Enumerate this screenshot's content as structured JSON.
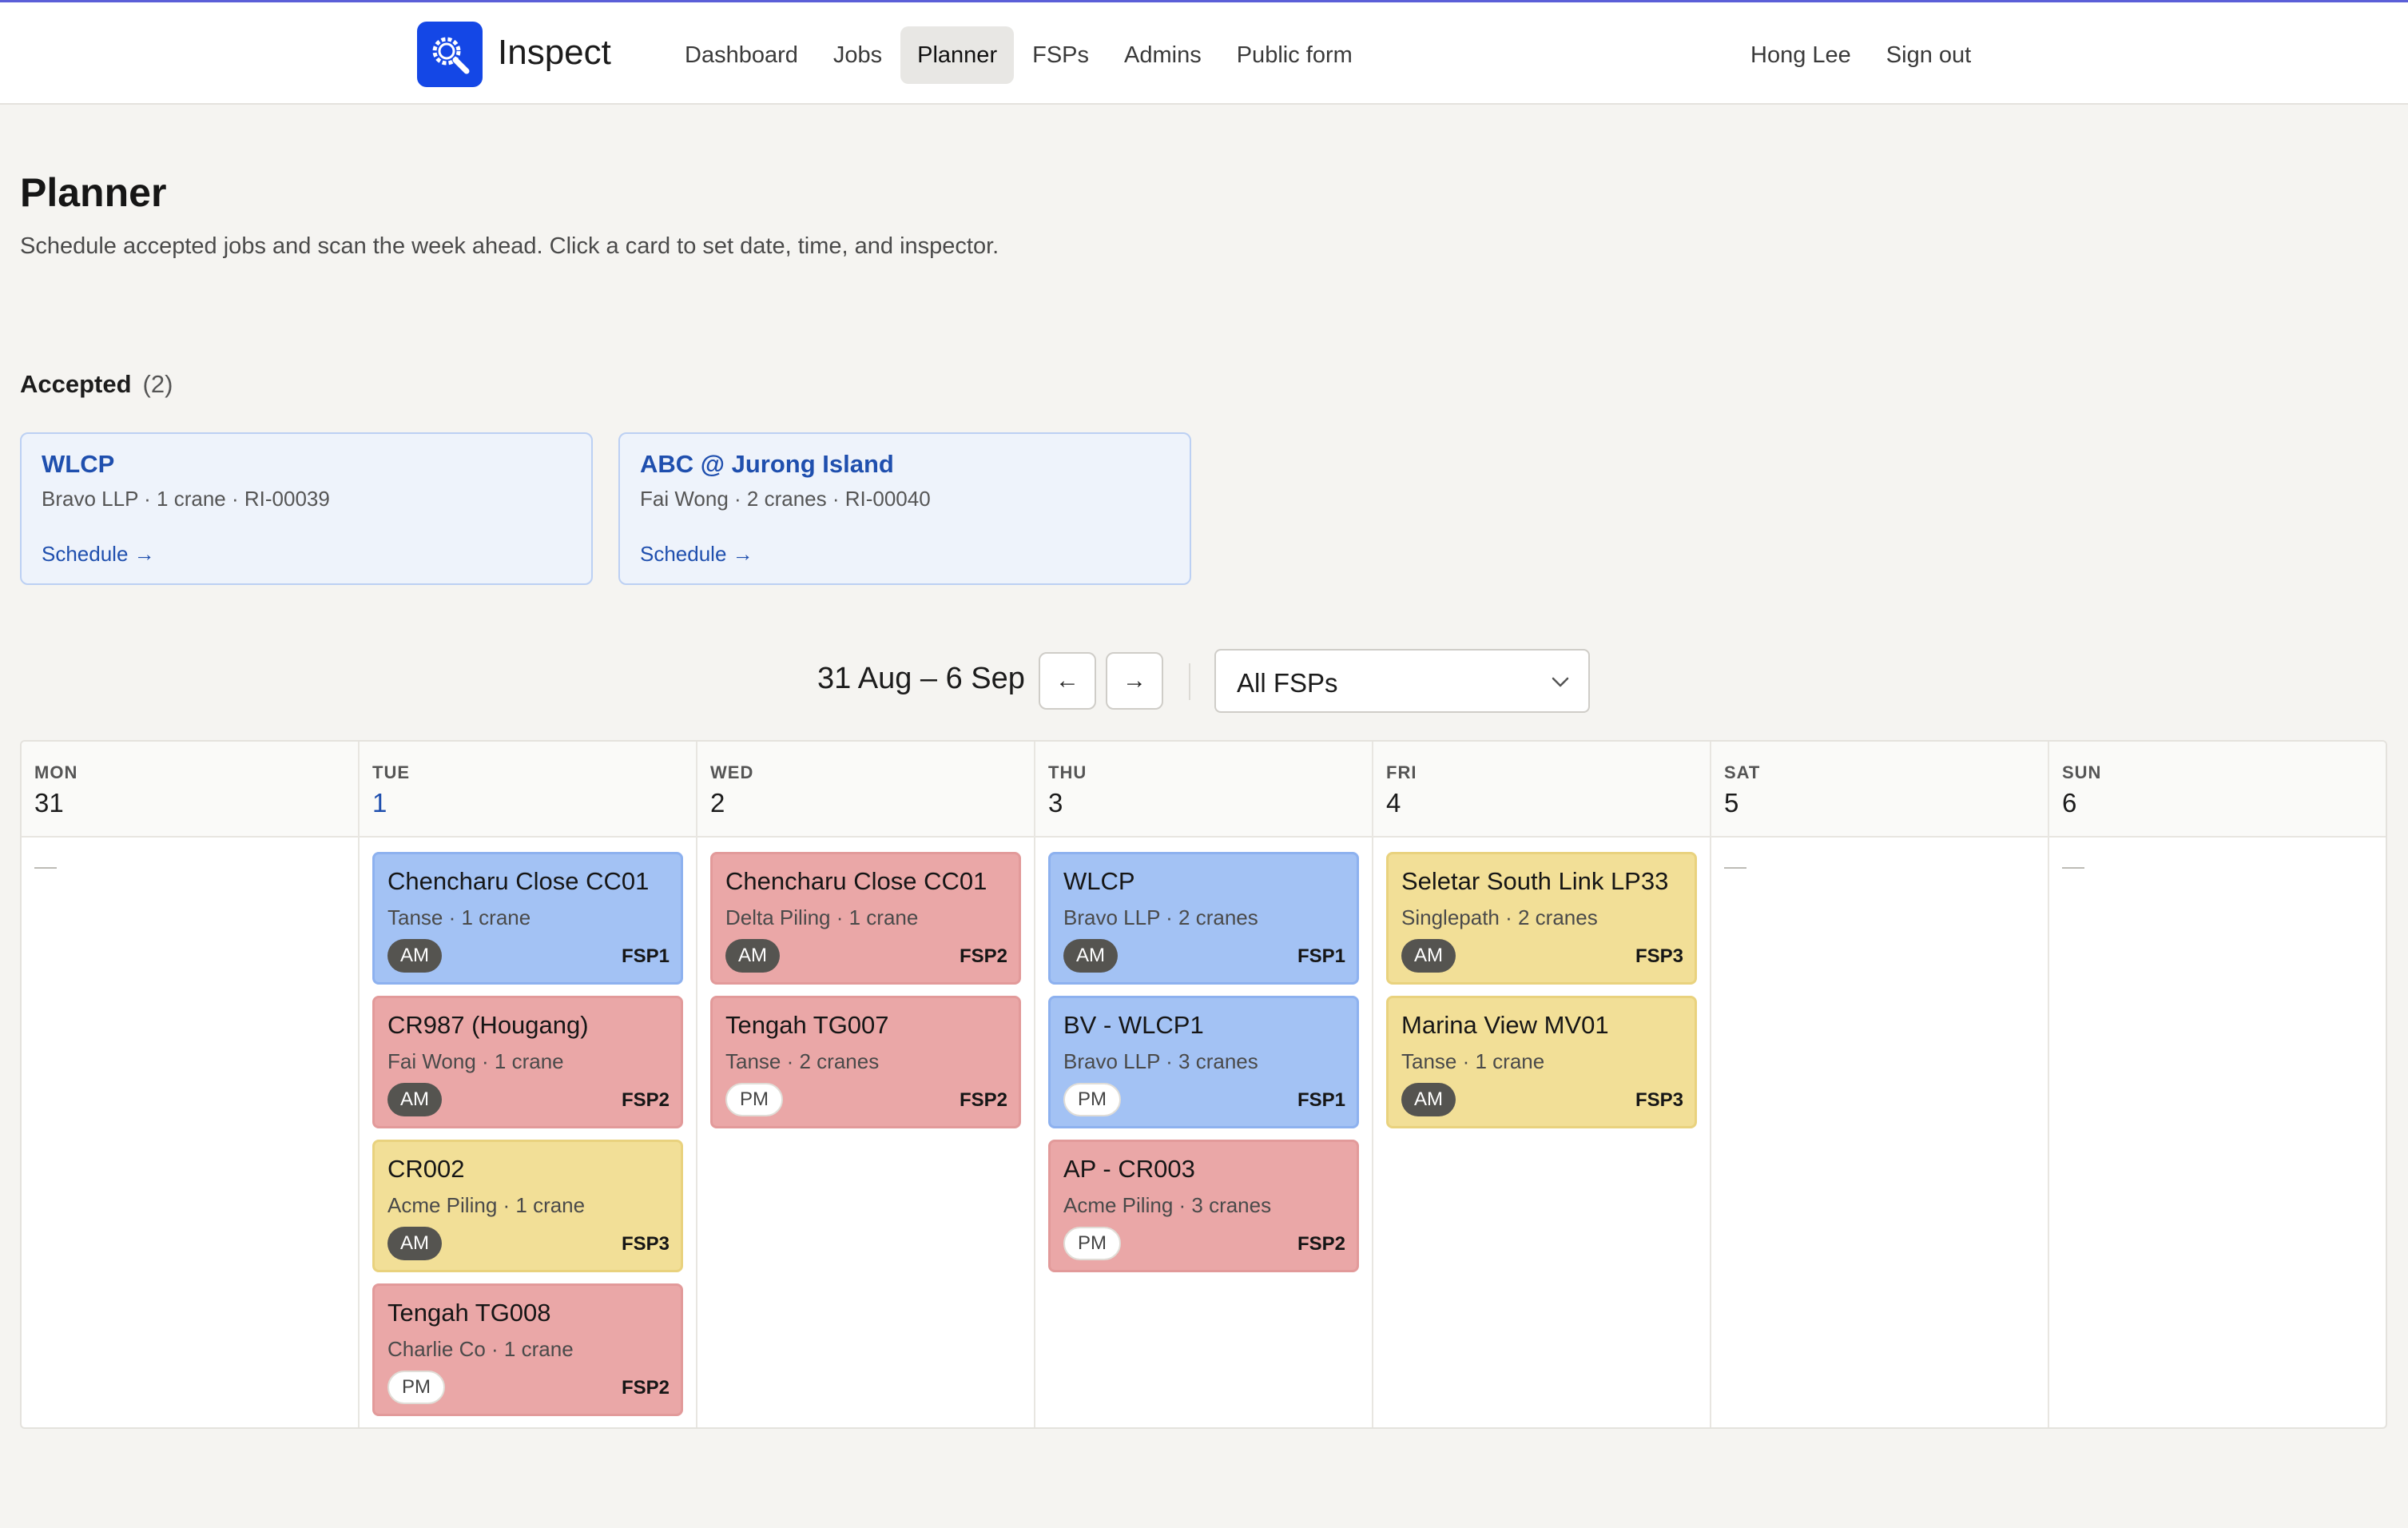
{
  "nav": {
    "brand": "Inspect",
    "items": [
      {
        "label": "Dashboard",
        "active": false
      },
      {
        "label": "Jobs",
        "active": false
      },
      {
        "label": "Planner",
        "active": true
      },
      {
        "label": "FSPs",
        "active": false
      },
      {
        "label": "Admins",
        "active": false
      },
      {
        "label": "Public form",
        "active": false
      }
    ],
    "user_name": "Hong Lee",
    "sign_out": "Sign out"
  },
  "page": {
    "title": "Planner",
    "description": "Schedule accepted jobs and scan the week ahead. Click a card to set date, time, and inspector."
  },
  "accepted": {
    "heading": "Accepted",
    "count": "(2)",
    "cards": [
      {
        "title": "WLCP",
        "subtitle": "Bravo LLP · 1 crane · RI-00039",
        "link": "Schedule →"
      },
      {
        "title": "ABC @ Jurong Island",
        "subtitle": "Fai Wong · 2 cranes · RI-00040",
        "link": "Schedule →"
      }
    ]
  },
  "week": {
    "range": "31 Aug – 6 Sep",
    "prev_icon": "←",
    "next_icon": "→",
    "filter_value": "All FSPs"
  },
  "colors": {
    "brand": "#1447e6",
    "blue": "#a3c2f4",
    "red": "#eaa7a7",
    "yellow": "#f2df97",
    "link": "#1f4fae"
  },
  "calendar": {
    "days": [
      {
        "name": "MON",
        "num": "31",
        "today": false,
        "empty": "—",
        "jobs": []
      },
      {
        "name": "TUE",
        "num": "1",
        "today": true,
        "empty": "",
        "jobs": [
          {
            "title": "Chencharu Close CC01",
            "sub": "Tanse · 1 crane",
            "slot": "AM",
            "fsp": "FSP1",
            "color": "blue"
          },
          {
            "title": "CR987 (Hougang)",
            "sub": "Fai Wong · 1 crane",
            "slot": "AM",
            "fsp": "FSP2",
            "color": "red"
          },
          {
            "title": "CR002",
            "sub": "Acme Piling · 1 crane",
            "slot": "AM",
            "fsp": "FSP3",
            "color": "yellow"
          },
          {
            "title": "Tengah TG008",
            "sub": "Charlie Co · 1 crane",
            "slot": "PM",
            "fsp": "FSP2",
            "color": "red"
          }
        ]
      },
      {
        "name": "WED",
        "num": "2",
        "today": false,
        "empty": "",
        "jobs": [
          {
            "title": "Chencharu Close CC01",
            "sub": "Delta Piling · 1 crane",
            "slot": "AM",
            "fsp": "FSP2",
            "color": "red"
          },
          {
            "title": "Tengah TG007",
            "sub": "Tanse · 2 cranes",
            "slot": "PM",
            "fsp": "FSP2",
            "color": "red"
          }
        ]
      },
      {
        "name": "THU",
        "num": "3",
        "today": false,
        "empty": "",
        "jobs": [
          {
            "title": "WLCP",
            "sub": "Bravo LLP · 2 cranes",
            "slot": "AM",
            "fsp": "FSP1",
            "color": "blue"
          },
          {
            "title": "BV - WLCP1",
            "sub": "Bravo LLP · 3 cranes",
            "slot": "PM",
            "fsp": "FSP1",
            "color": "blue"
          },
          {
            "title": "AP - CR003",
            "sub": "Acme Piling · 3 cranes",
            "slot": "PM",
            "fsp": "FSP2",
            "color": "red"
          }
        ]
      },
      {
        "name": "FRI",
        "num": "4",
        "today": false,
        "empty": "",
        "jobs": [
          {
            "title": "Seletar South Link LP33",
            "sub": "Singlepath · 2 cranes",
            "slot": "AM",
            "fsp": "FSP3",
            "color": "yellow"
          },
          {
            "title": "Marina View MV01",
            "sub": "Tanse · 1 crane",
            "slot": "AM",
            "fsp": "FSP3",
            "color": "yellow"
          }
        ]
      },
      {
        "name": "SAT",
        "num": "5",
        "today": false,
        "empty": "—",
        "jobs": []
      },
      {
        "name": "SUN",
        "num": "6",
        "today": false,
        "empty": "—",
        "jobs": []
      }
    ]
  }
}
